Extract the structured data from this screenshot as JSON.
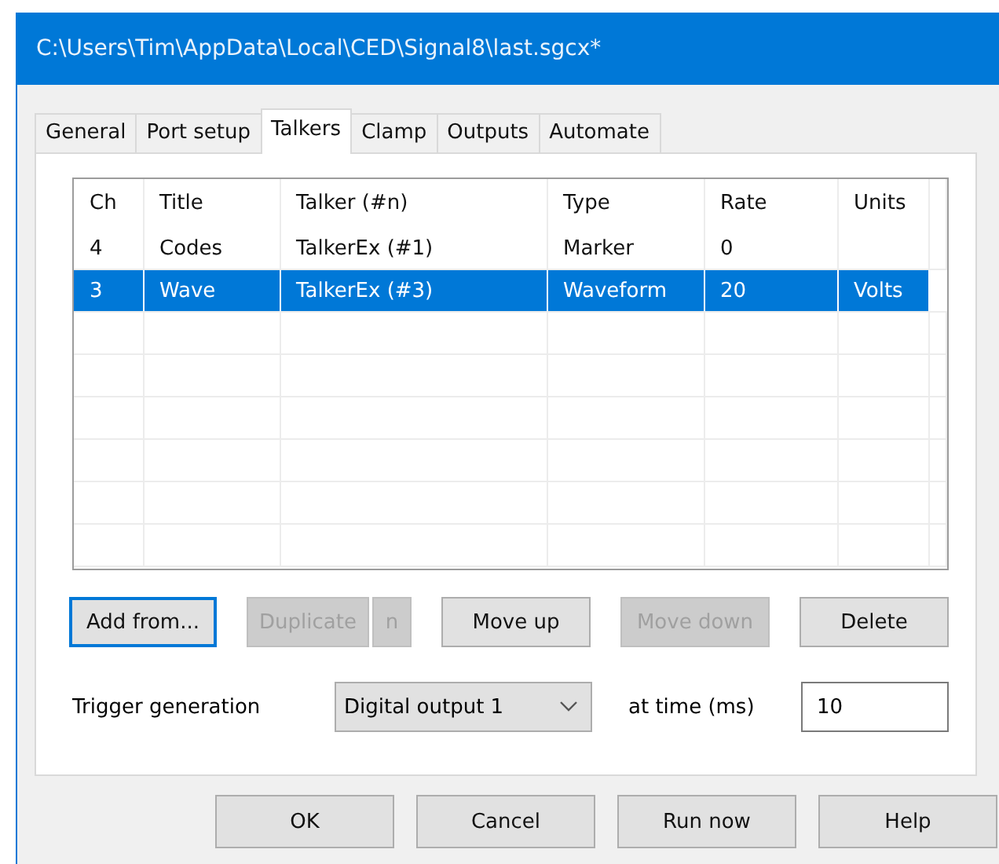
{
  "window": {
    "title": "C:\\Users\\Tim\\AppData\\Local\\CED\\Signal8\\last.sgcx*"
  },
  "tabs": [
    {
      "label": "General",
      "selected": false
    },
    {
      "label": "Port setup",
      "selected": false
    },
    {
      "label": "Talkers",
      "selected": true
    },
    {
      "label": "Clamp",
      "selected": false
    },
    {
      "label": "Outputs",
      "selected": false
    },
    {
      "label": "Automate",
      "selected": false
    }
  ],
  "table": {
    "columns": [
      "Ch",
      "Title",
      "Talker (#n)",
      "Type",
      "Rate",
      "Units"
    ],
    "rows": [
      {
        "cells": [
          "4",
          "Codes",
          "TalkerEx (#1)",
          "Marker",
          "0",
          ""
        ],
        "selected": false
      },
      {
        "cells": [
          "3",
          "Wave",
          "TalkerEx (#3)",
          "Waveform",
          "20",
          "Volts"
        ],
        "selected": true
      }
    ]
  },
  "actions": [
    {
      "label": "Add from...",
      "disabled": false,
      "focused": true
    },
    {
      "label": "Duplicate",
      "disabled": true,
      "focused": false
    },
    {
      "label": "n",
      "disabled": true,
      "focused": false
    },
    {
      "label": "Move up",
      "disabled": false,
      "focused": false
    },
    {
      "label": "Move down",
      "disabled": true,
      "focused": false
    },
    {
      "label": "Delete",
      "disabled": false,
      "focused": false
    }
  ],
  "trigger": {
    "label": "Trigger generation",
    "dropdown": "Digital output 1",
    "time_label": "at time (ms)",
    "time_value": "10"
  },
  "dialog_buttons": [
    "OK",
    "Cancel",
    "Run now",
    "Help"
  ]
}
